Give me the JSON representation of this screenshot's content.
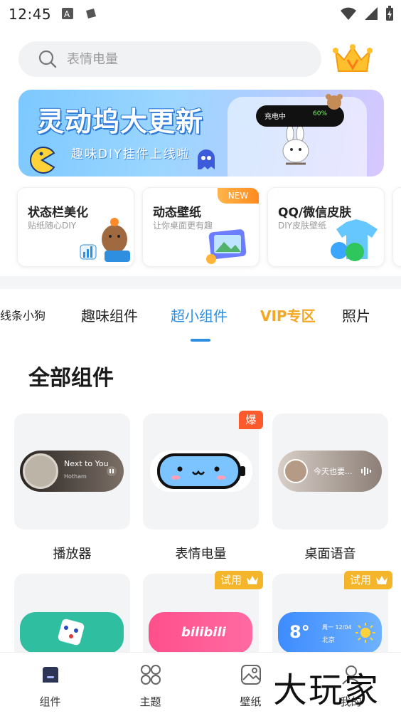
{
  "status_bar": {
    "time": "12:45"
  },
  "search": {
    "placeholder": "表情电量"
  },
  "banner": {
    "title": "灵动坞大更新",
    "subtitle": "趣味DIY挂件上线啦",
    "island_text": "充电中",
    "island_battery": "60%"
  },
  "features": [
    {
      "title": "状态栏美化",
      "subtitle": "贴纸随心DIY"
    },
    {
      "title": "动态壁纸",
      "subtitle": "让你桌面更有趣",
      "badge": "NEW"
    },
    {
      "title": "QQ/微信皮肤",
      "subtitle": "DIY皮肤壁纸"
    }
  ],
  "tabs": [
    {
      "label": "线条小狗"
    },
    {
      "label": "趣味组件"
    },
    {
      "label": "超小组件",
      "active": true
    },
    {
      "label": "VIP专区"
    },
    {
      "label": "照片"
    }
  ],
  "section_title": "全部组件",
  "widgets": [
    {
      "label": "播放器",
      "preview_title": "Next to You",
      "preview_sub": "Hotham"
    },
    {
      "label": "表情电量",
      "badge": "爆"
    },
    {
      "label": "桌面语音",
      "preview_title": "今天也要..."
    },
    {
      "label": "",
      "badge": ""
    },
    {
      "label": "",
      "badge": "试用",
      "preview_title": "bilibili"
    },
    {
      "label": "",
      "badge": "试用",
      "preview_title": "8°",
      "preview_date": "周一 12/04",
      "preview_city": "北京"
    }
  ],
  "bottom_nav": [
    {
      "label": "组件",
      "active": true
    },
    {
      "label": "主题"
    },
    {
      "label": "壁纸"
    },
    {
      "label": "我的"
    }
  ],
  "watermark": "大玩家",
  "colors": {
    "accent": "#2e8fe0",
    "vip": "#f5a623",
    "hot": "#ff5a2c",
    "trial": "#f5b52b"
  }
}
